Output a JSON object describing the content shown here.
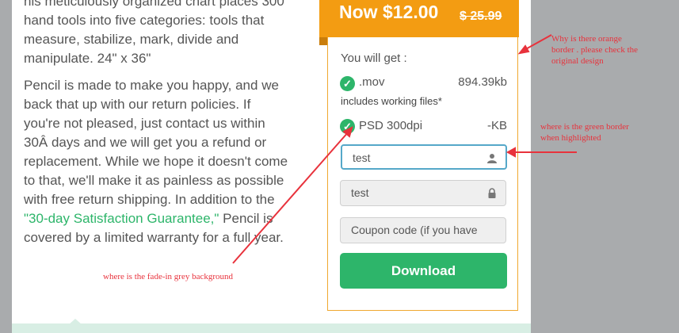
{
  "description": {
    "para1_lines": [
      "his meticulously organized chart places 300",
      "hand tools into five categories: tools that",
      "measure, stabilize, mark, divide and",
      "manipulate. 24\" x 36\""
    ],
    "para2_lines_before": [
      "Pencil is made to make you happy, and we",
      "back that up with our return policies. If",
      "you're not pleased, just contact us within",
      "30Â days and we will get you a refund or",
      "replacement. While we hope it doesn't come",
      "to that, we'll make it as painless as possible",
      "with free return shipping. In addition to the"
    ],
    "guarantee_link": "\"30-day Satisfaction Guarantee,\"",
    "after_link": " Pencil is",
    "para2_last": "covered by a limited warranty for a full year."
  },
  "price": {
    "now": "Now $12.00",
    "old": "$ 25.99"
  },
  "panel": {
    "heading": "You will get :",
    "items": [
      {
        "name": ".mov",
        "size": "894.39kb",
        "note": "includes working files*"
      },
      {
        "name": "PSD 300dpi",
        "size": "-KB"
      }
    ],
    "username_value": "test",
    "password_value": "test",
    "coupon_placeholder": "Coupon code (if you have",
    "download_label": "Download"
  },
  "annotations": {
    "orange": [
      "Why is there orange",
      "border . please check the",
      "original design"
    ],
    "green": [
      "where is the green border",
      "when highlighted"
    ],
    "grey": "where is the fade-in grey background"
  },
  "colors": {
    "accent_green": "#2db56a",
    "orange": "#f39c12",
    "focus_border": "#55a8c9",
    "annotation_red": "#e8323c"
  }
}
